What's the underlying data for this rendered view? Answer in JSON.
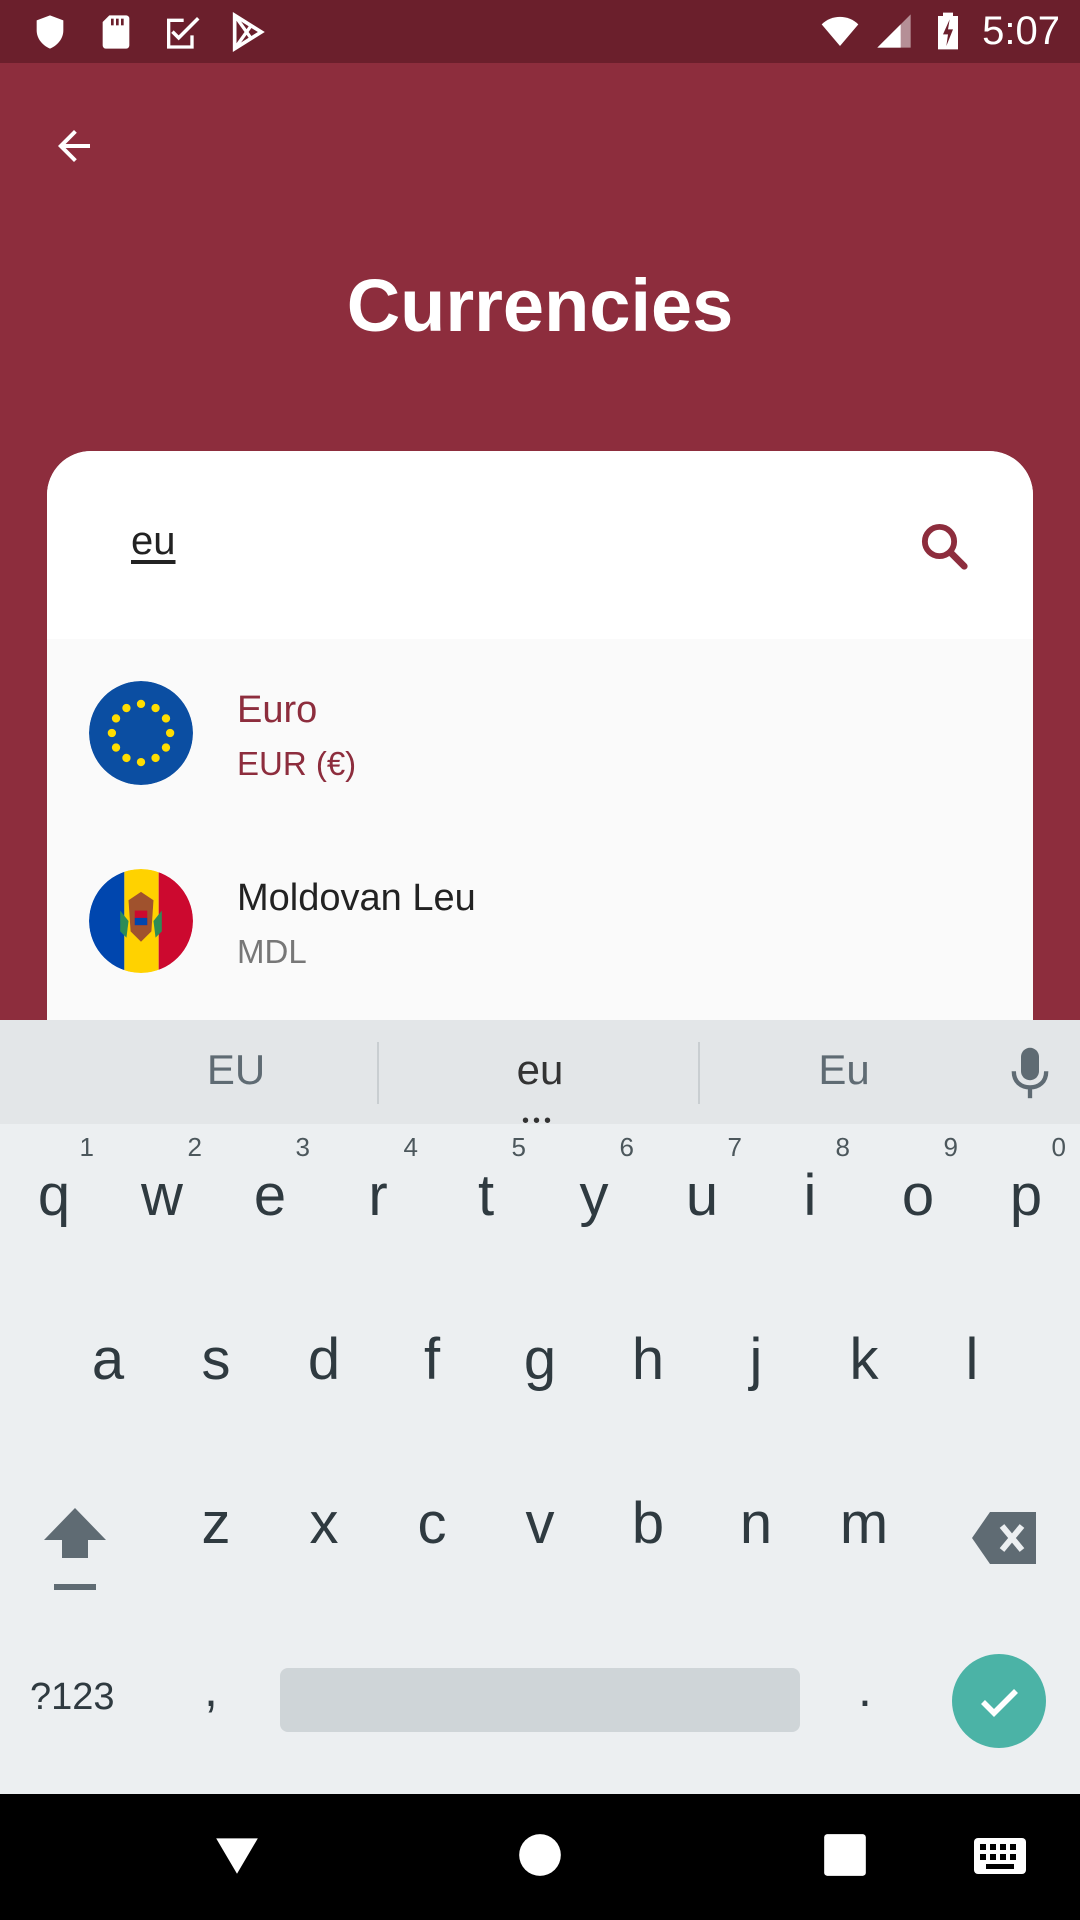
{
  "status_bar": {
    "time": "5:07",
    "icons": [
      "shield-icon",
      "sd-card-icon",
      "task-icon",
      "play-store-icon",
      "wifi-icon",
      "signal-icon",
      "battery-charging-icon"
    ]
  },
  "header": {
    "title": "Currencies",
    "back_icon": "arrow-back-icon"
  },
  "search": {
    "value": "eu",
    "icon": "search-icon"
  },
  "results": [
    {
      "name": "Euro",
      "code": "EUR (€)",
      "flag": "eu-flag",
      "selected": true
    },
    {
      "name": "Moldovan Leu",
      "code": "MDL",
      "flag": "moldova-flag",
      "selected": false
    }
  ],
  "keyboard": {
    "suggestions": [
      "EU",
      "eu",
      "Eu"
    ],
    "row1": [
      {
        "k": "q",
        "n": "1"
      },
      {
        "k": "w",
        "n": "2"
      },
      {
        "k": "e",
        "n": "3"
      },
      {
        "k": "r",
        "n": "4"
      },
      {
        "k": "t",
        "n": "5"
      },
      {
        "k": "y",
        "n": "6"
      },
      {
        "k": "u",
        "n": "7"
      },
      {
        "k": "i",
        "n": "8"
      },
      {
        "k": "o",
        "n": "9"
      },
      {
        "k": "p",
        "n": "0"
      }
    ],
    "row2": [
      "a",
      "s",
      "d",
      "f",
      "g",
      "h",
      "j",
      "k",
      "l"
    ],
    "row3": [
      "z",
      "x",
      "c",
      "v",
      "b",
      "n",
      "m"
    ],
    "symbols_label": "?123",
    "comma": ",",
    "period": "."
  },
  "colors": {
    "primary": "#8d2d3d",
    "status_bar": "#6b1f2c",
    "accent_done": "#4bb3a6"
  }
}
